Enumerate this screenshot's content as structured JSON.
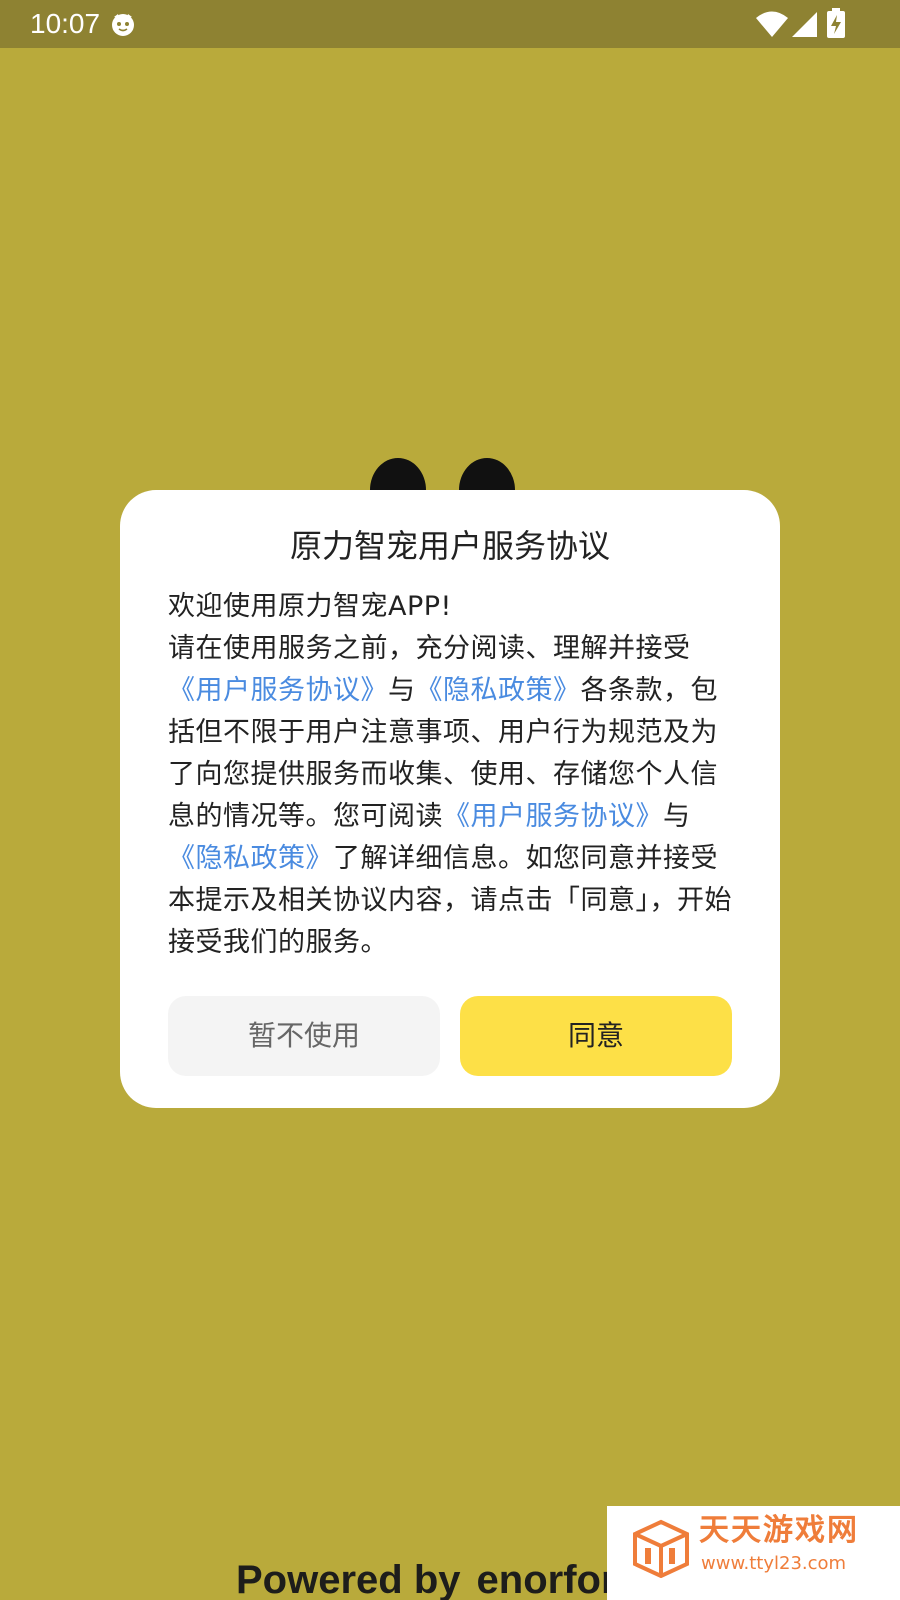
{
  "status_bar": {
    "time": "10:07"
  },
  "dialog": {
    "title": "原力智宠用户服务协议",
    "welcome": "欢迎使用原力智宠APP!",
    "p1_a": "请在使用服务之前，充分阅读、理解并接受",
    "link_user_agreement": "《用户服务协议》",
    "and_1": "与",
    "link_privacy": "《隐私政策》",
    "p1_b": "各条款，包括但不限于用户注意事项、用户行为规范及为了向您提供服务而收集、使用、存储您个人信息的情况等。您可阅读",
    "link_user_agreement_2": "《用户服务协议》",
    "and_2": "与",
    "link_privacy_2": "《隐私政策》",
    "p1_c": "了解详细信息。如您同意并接受本提示及相关协议内容，请点击「同意」，开始接受我们的服务。",
    "decline_label": "暂不使用",
    "agree_label": "同意"
  },
  "footer": {
    "powered_by": "Powered by",
    "brand": "enorfor"
  },
  "watermark": {
    "title": "天天游戏网",
    "url": "www.ttyl23.com"
  },
  "colors": {
    "background": "#b9aa3b",
    "status_bar": "#8e8232",
    "link": "#4a8be0",
    "agree_button": "#fde047",
    "decline_button": "#f4f4f4"
  }
}
